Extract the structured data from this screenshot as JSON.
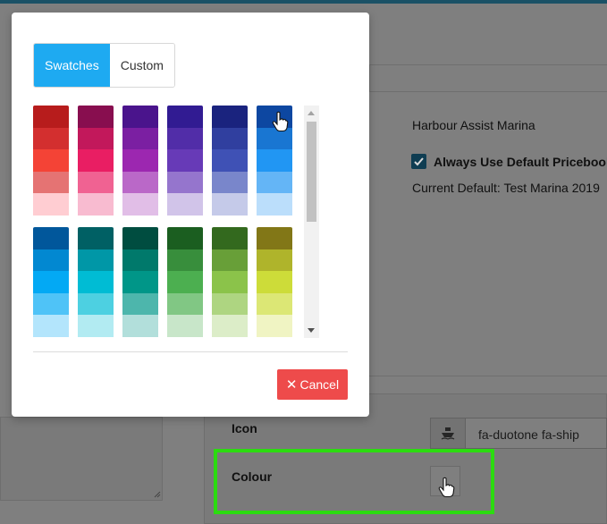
{
  "background": {
    "company_name": "Harbour Assist Marina",
    "default_pricebook_label": "Always Use Default Pricebook?",
    "default_pricebook_checked": true,
    "current_default": "Current Default: Test Marina 2019",
    "icon_label": "Icon",
    "icon_value": "fa-duotone fa-ship",
    "icon_preview": "ship-icon",
    "colour_label": "Colour"
  },
  "modal": {
    "tabs": [
      {
        "label": "Swatches",
        "active": true
      },
      {
        "label": "Custom",
        "active": false
      }
    ],
    "cancel_label": "Cancel",
    "cancel_icon": "close-icon"
  },
  "swatch_groups": [
    [
      [
        "#b71c1c",
        "#d32f2f",
        "#f44336",
        "#e57373",
        "#ffcdd2"
      ],
      [
        "#880e4f",
        "#c2185b",
        "#e91e63",
        "#f06292",
        "#f8bbd0"
      ],
      [
        "#4a148c",
        "#7b1fa2",
        "#9c27b0",
        "#ba68c8",
        "#e1bee7"
      ],
      [
        "#311b92",
        "#512da8",
        "#673ab7",
        "#9575cd",
        "#d1c4e9"
      ],
      [
        "#1a237e",
        "#303f9f",
        "#3f51b5",
        "#7986cb",
        "#c5cae9"
      ],
      [
        "#0d47a1",
        "#1976d2",
        "#2196f3",
        "#64b5f6",
        "#bbdefb"
      ]
    ],
    [
      [
        "#01579b",
        "#0288d1",
        "#03a9f4",
        "#4fc3f7",
        "#b3e5fc"
      ],
      [
        "#006064",
        "#0097a7",
        "#00bcd4",
        "#4dd0e1",
        "#b2ebf2"
      ],
      [
        "#004d40",
        "#00796b",
        "#009688",
        "#4db6ac",
        "#b2dfdb"
      ],
      [
        "#1b5e20",
        "#388e3c",
        "#4caf50",
        "#81c784",
        "#c8e6c9"
      ],
      [
        "#33691e",
        "#689f38",
        "#8bc34a",
        "#aed581",
        "#dcedc8"
      ],
      [
        "#827717",
        "#afb42b",
        "#cddc39",
        "#dce775",
        "#f0f4c3"
      ]
    ]
  ],
  "colors": {
    "accent": "#1eaaf1",
    "cancel": "#ee4b4b",
    "highlight": "#2bdc10"
  }
}
